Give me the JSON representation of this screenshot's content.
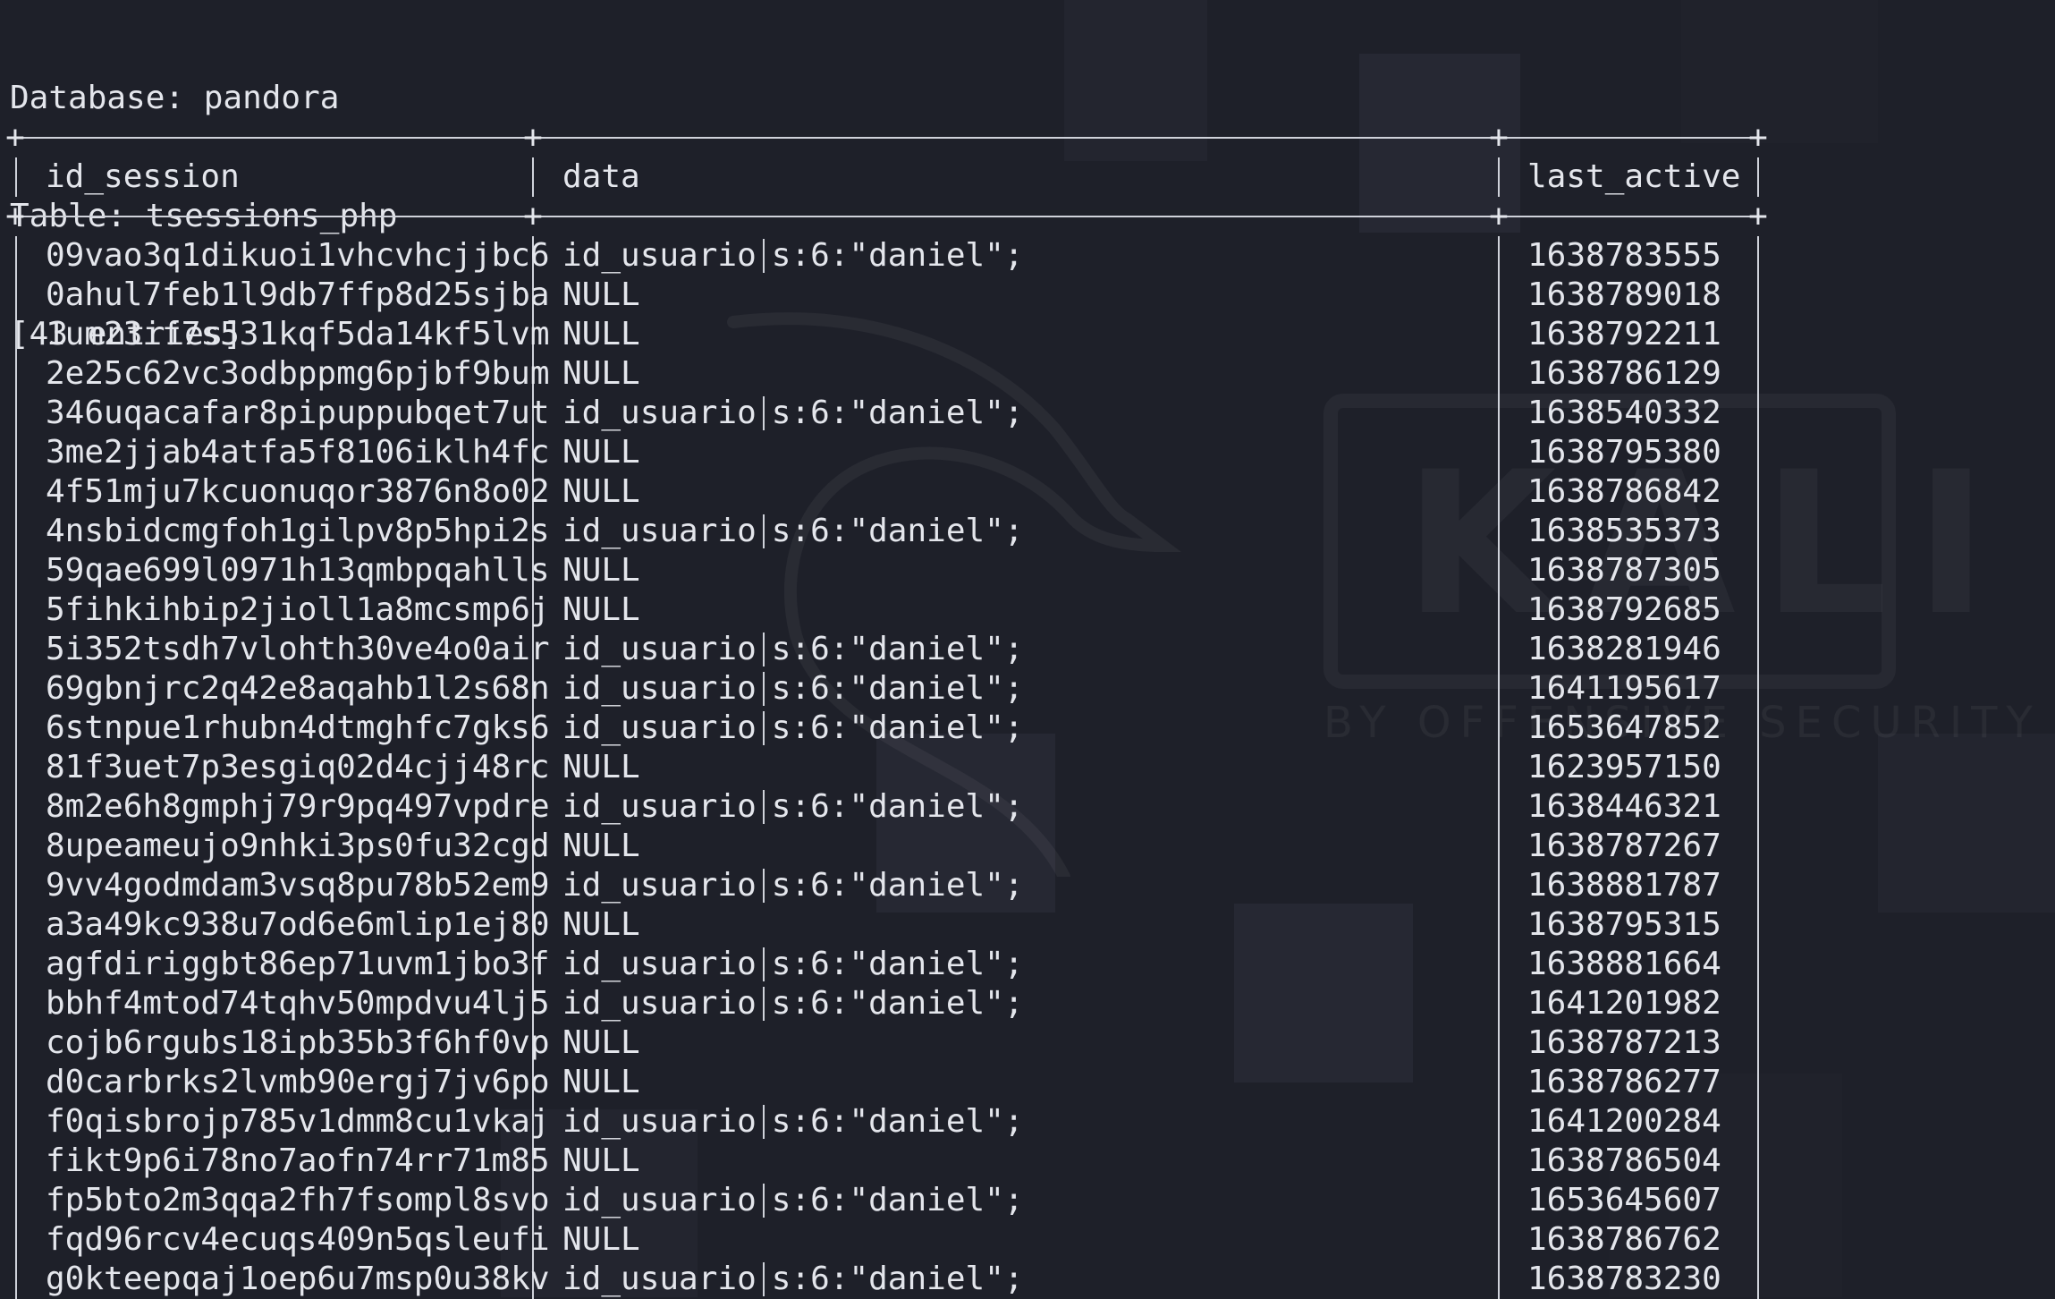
{
  "terminal": {
    "database_line": "Database: pandora",
    "table_line": "Table: tsessions_php",
    "entries_line": "[43 entries]"
  },
  "watermark": {
    "brand": "KALI",
    "tagline": "BY OFFENSIVE SECURITY"
  },
  "table": {
    "headers": [
      "id_session",
      "data",
      "last_active"
    ],
    "rows": [
      {
        "id_session": "09vao3q1dikuoi1vhcvhcjjbc6",
        "data_key": "id_usuario",
        "data_val": "s:6:\"daniel\";",
        "last_active": "1638783555"
      },
      {
        "id_session": "0ahul7feb1l9db7ffp8d25sjba",
        "data_key": "",
        "data_val": "NULL",
        "last_active": "1638789018"
      },
      {
        "id_session": "1um23if7s531kqf5da14kf5lvm",
        "data_key": "",
        "data_val": "NULL",
        "last_active": "1638792211"
      },
      {
        "id_session": "2e25c62vc3odbppmg6pjbf9bum",
        "data_key": "",
        "data_val": "NULL",
        "last_active": "1638786129"
      },
      {
        "id_session": "346uqacafar8pipuppubqet7ut",
        "data_key": "id_usuario",
        "data_val": "s:6:\"daniel\";",
        "last_active": "1638540332"
      },
      {
        "id_session": "3me2jjab4atfa5f8106iklh4fc",
        "data_key": "",
        "data_val": "NULL",
        "last_active": "1638795380"
      },
      {
        "id_session": "4f51mju7kcuonuqor3876n8o02",
        "data_key": "",
        "data_val": "NULL",
        "last_active": "1638786842"
      },
      {
        "id_session": "4nsbidcmgfoh1gilpv8p5hpi2s",
        "data_key": "id_usuario",
        "data_val": "s:6:\"daniel\";",
        "last_active": "1638535373"
      },
      {
        "id_session": "59qae699l0971h13qmbpqahlls",
        "data_key": "",
        "data_val": "NULL",
        "last_active": "1638787305"
      },
      {
        "id_session": "5fihkihbip2jioll1a8mcsmp6j",
        "data_key": "",
        "data_val": "NULL",
        "last_active": "1638792685"
      },
      {
        "id_session": "5i352tsdh7vlohth30ve4o0air",
        "data_key": "id_usuario",
        "data_val": "s:6:\"daniel\";",
        "last_active": "1638281946"
      },
      {
        "id_session": "69gbnjrc2q42e8aqahb1l2s68n",
        "data_key": "id_usuario",
        "data_val": "s:6:\"daniel\";",
        "last_active": "1641195617"
      },
      {
        "id_session": "6stnpue1rhubn4dtmghfc7gks6",
        "data_key": "id_usuario",
        "data_val": "s:6:\"daniel\";",
        "last_active": "1653647852"
      },
      {
        "id_session": "81f3uet7p3esgiq02d4cjj48rc",
        "data_key": "",
        "data_val": "NULL",
        "last_active": "1623957150"
      },
      {
        "id_session": "8m2e6h8gmphj79r9pq497vpdre",
        "data_key": "id_usuario",
        "data_val": "s:6:\"daniel\";",
        "last_active": "1638446321"
      },
      {
        "id_session": "8upeameujo9nhki3ps0fu32cgd",
        "data_key": "",
        "data_val": "NULL",
        "last_active": "1638787267"
      },
      {
        "id_session": "9vv4godmdam3vsq8pu78b52em9",
        "data_key": "id_usuario",
        "data_val": "s:6:\"daniel\";",
        "last_active": "1638881787"
      },
      {
        "id_session": "a3a49kc938u7od6e6mlip1ej80",
        "data_key": "",
        "data_val": "NULL",
        "last_active": "1638795315"
      },
      {
        "id_session": "agfdiriggbt86ep71uvm1jbo3f",
        "data_key": "id_usuario",
        "data_val": "s:6:\"daniel\";",
        "last_active": "1638881664"
      },
      {
        "id_session": "bbhf4mtod74tqhv50mpdvu4lj5",
        "data_key": "id_usuario",
        "data_val": "s:6:\"daniel\";",
        "last_active": "1641201982"
      },
      {
        "id_session": "cojb6rgubs18ipb35b3f6hf0vp",
        "data_key": "",
        "data_val": "NULL",
        "last_active": "1638787213"
      },
      {
        "id_session": "d0carbrks2lvmb90ergj7jv6po",
        "data_key": "",
        "data_val": "NULL",
        "last_active": "1638786277"
      },
      {
        "id_session": "f0qisbrojp785v1dmm8cu1vkaj",
        "data_key": "id_usuario",
        "data_val": "s:6:\"daniel\";",
        "last_active": "1641200284"
      },
      {
        "id_session": "fikt9p6i78no7aofn74rr71m85",
        "data_key": "",
        "data_val": "NULL",
        "last_active": "1638786504"
      },
      {
        "id_session": "fp5bto2m3qqa2fh7fsompl8svo",
        "data_key": "id_usuario",
        "data_val": "s:6:\"daniel\";",
        "last_active": "1653645607"
      },
      {
        "id_session": "fqd96rcv4ecuqs409n5qsleufi",
        "data_key": "",
        "data_val": "NULL",
        "last_active": "1638786762"
      },
      {
        "id_session": "g0kteepqaj1oep6u7msp0u38kv",
        "data_key": "id_usuario",
        "data_val": "s:6:\"daniel\";",
        "last_active": "1638783230"
      }
    ]
  }
}
